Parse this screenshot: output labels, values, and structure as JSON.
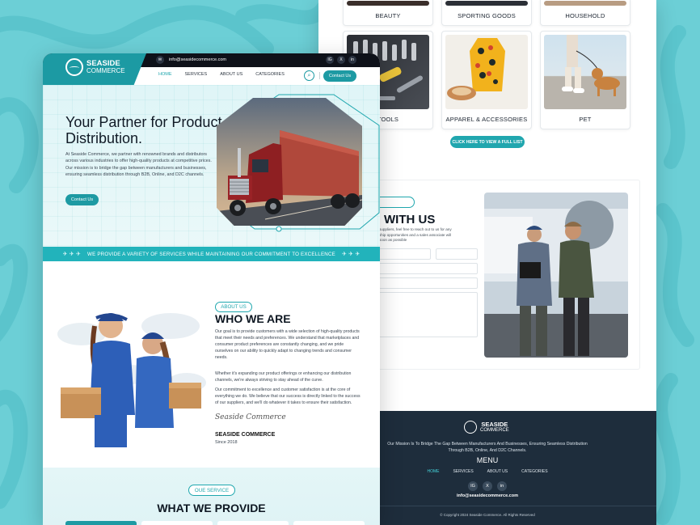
{
  "brand": {
    "name_line1": "SEASIDE",
    "name_line2": "COMMERCE",
    "accent": "#1d9aa3",
    "dark": "#1e2d3c"
  },
  "topbar": {
    "email": "info@seasidecommerce.com",
    "email_icon": "mail-icon",
    "social": [
      "IG",
      "X",
      "in"
    ]
  },
  "nav": {
    "items": [
      "HOME",
      "SERVICES",
      "ABOUT US",
      "CATEGORIES"
    ],
    "active": "HOME",
    "contact_button": "Contact Us",
    "search_icon": "search-icon"
  },
  "hero": {
    "title": "Your Partner for Product Distribution.",
    "text": "At Seaside Commerce, we partner with renowned brands and distributors across various industries to offer high-quality products at competitive prices. Our mission is to bridge the gap between manufacturers and businesses, ensuring seamless distribution through B2B, Online, and D2C channels.",
    "button": "Contact Us"
  },
  "banner": {
    "text": "WE PROVIDE A VARIETY OF SERVICES WHILE MAINTAINING OUR COMMITMENT TO EXCELLENCE"
  },
  "about": {
    "pill": "ABOUT US",
    "title": "WHO WE ARE",
    "p1": "Our goal is to provide customers with a wide selection of high-quality products that meet their needs and preferences. We understand that marketplaces and consumer product preferences are constantly changing, and we pride ourselves on our ability to quickly adapt to changing trends and consumer needs.",
    "p2": "Whether it's expanding our product offerings or enhancing our distribution channels, we're always striving to stay ahead of the curve.",
    "p3": "Our commitment to excellence and customer satisfaction is at the core of everything we do. We believe that our success is directly linked to the success of our suppliers, and we'll do whatever it takes to ensure their satisfaction.",
    "signature": "Seaside Commerce",
    "name": "SEASIDE COMMERCE",
    "since": "Since 2018"
  },
  "services": {
    "pill": "OUE SERVICE",
    "title": "WHAT WE PROVIDE"
  },
  "categories": {
    "top_row": [
      "BEAUTY",
      "SPORTING GOODS",
      "HOUSEHOLD"
    ],
    "row2": [
      "TOOLS",
      "APPAREL & ACCESSORIES",
      "PET"
    ],
    "view_button": "CLICK HERE TO VIEW A FULL LIST"
  },
  "contact": {
    "title": "WITH US",
    "text_lines": [
      "suppliers, feel free to reach out to us for any",
      "ship opportunities and a sales associate will",
      "soon as possible"
    ]
  },
  "footer": {
    "mission": "Our Mission Is To Bridge The Gap Between Manufacturers And Businesses, Ensuring Seamless Distribution Through B2B, Online, And D2C Channels.",
    "menu_title": "MENU",
    "links": [
      "HOME",
      "SERVICES",
      "ABOUT US",
      "CATEGORIES"
    ],
    "social": [
      "IG",
      "X",
      "in"
    ],
    "email": "info@seasidecommerce.com",
    "copyright": "© Copyright 2024 Seaside Commerce. All Rights Reserved"
  }
}
